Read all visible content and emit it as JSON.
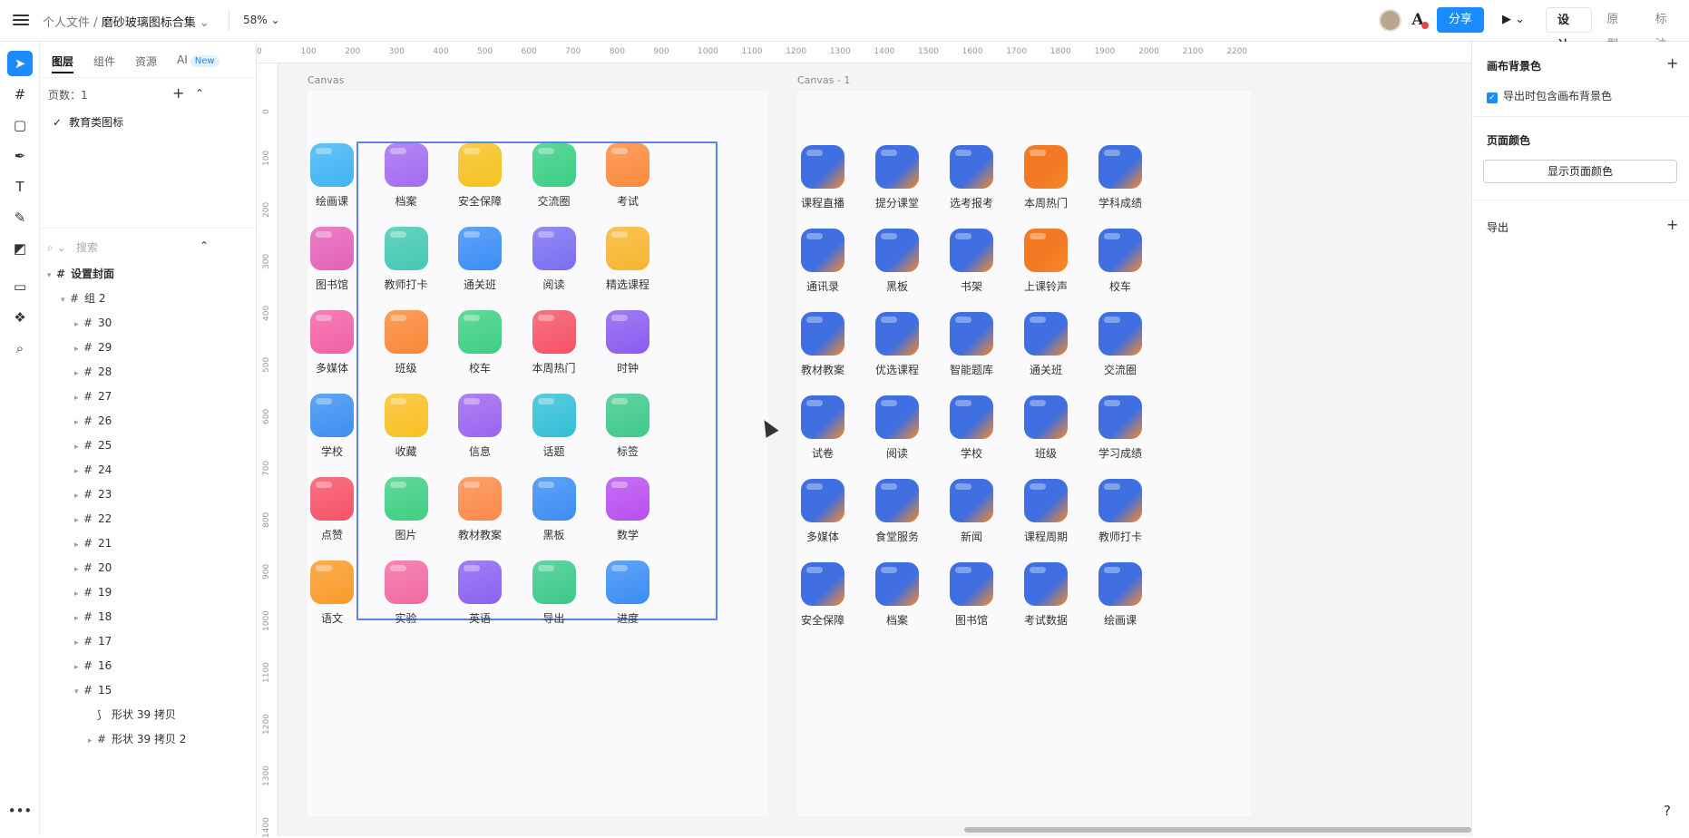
{
  "topbar": {
    "breadcrumb_root": "个人文件",
    "breadcrumb_sep": "/",
    "file_name": "磨砂玻璃图标合集",
    "zoom": "58%",
    "share_label": "分享",
    "modes": [
      "设计",
      "原型",
      "标注"
    ]
  },
  "left_panel": {
    "tabs": [
      "图层",
      "组件",
      "资源",
      "AI"
    ],
    "new_badge": "New",
    "page_count": "页数：1",
    "page_name": "教育类图标",
    "search_placeholder": "搜索",
    "layers": [
      {
        "label": "设置封面",
        "indent": 0,
        "arrow": "▾"
      },
      {
        "label": "组 2",
        "indent": 1,
        "arrow": "▾"
      },
      {
        "label": "30",
        "indent": 2,
        "arrow": "▸"
      },
      {
        "label": "29",
        "indent": 2,
        "arrow": "▸"
      },
      {
        "label": "28",
        "indent": 2,
        "arrow": "▸"
      },
      {
        "label": "27",
        "indent": 2,
        "arrow": "▸"
      },
      {
        "label": "26",
        "indent": 2,
        "arrow": "▸"
      },
      {
        "label": "25",
        "indent": 2,
        "arrow": "▸"
      },
      {
        "label": "24",
        "indent": 2,
        "arrow": "▸"
      },
      {
        "label": "23",
        "indent": 2,
        "arrow": "▸"
      },
      {
        "label": "22",
        "indent": 2,
        "arrow": "▸"
      },
      {
        "label": "21",
        "indent": 2,
        "arrow": "▸"
      },
      {
        "label": "20",
        "indent": 2,
        "arrow": "▸"
      },
      {
        "label": "19",
        "indent": 2,
        "arrow": "▸"
      },
      {
        "label": "18",
        "indent": 2,
        "arrow": "▸"
      },
      {
        "label": "17",
        "indent": 2,
        "arrow": "▸"
      },
      {
        "label": "16",
        "indent": 2,
        "arrow": "▸"
      },
      {
        "label": "15",
        "indent": 2,
        "arrow": "▾"
      },
      {
        "label": "形状 39 拷贝",
        "indent": 3,
        "arrow": ""
      },
      {
        "label": "形状 39 拷贝 2",
        "indent": 3,
        "arrow": "▸"
      }
    ]
  },
  "canvas": {
    "ruler_h": [
      "0",
      "100",
      "200",
      "300",
      "400",
      "500",
      "600",
      "700",
      "800",
      "900",
      "1000",
      "1100",
      "1200",
      "1300",
      "1400",
      "1500",
      "1600",
      "1700",
      "1800",
      "1900",
      "2000",
      "2100",
      "2200"
    ],
    "ruler_v": [
      "0",
      "100",
      "200",
      "300",
      "400",
      "500",
      "600",
      "700",
      "800",
      "900",
      "1000",
      "1100",
      "1200",
      "1300",
      "1400"
    ],
    "artboard1_label": "Canvas",
    "artboard2_label": "Canvas - 1",
    "artboard1_icons": [
      {
        "label": "绘画课",
        "color": "#3fb4f4"
      },
      {
        "label": "档案",
        "color": "#a36bf0"
      },
      {
        "label": "安全保障",
        "color": "#f6c21f"
      },
      {
        "label": "交流圈",
        "color": "#38cf84"
      },
      {
        "label": "考试",
        "color": "#fb8a3c"
      },
      {
        "label": "图书馆",
        "color": "#e561b8"
      },
      {
        "label": "教师打卡",
        "color": "#43c9b2"
      },
      {
        "label": "通关班",
        "color": "#3a8df5"
      },
      {
        "label": "阅读",
        "color": "#7a6ef2"
      },
      {
        "label": "精选课程",
        "color": "#f7b52e"
      },
      {
        "label": "多媒体",
        "color": "#f260a5"
      },
      {
        "label": "班级",
        "color": "#fb8736"
      },
      {
        "label": "校车",
        "color": "#3dcf82"
      },
      {
        "label": "本周热门",
        "color": "#f65266"
      },
      {
        "label": "时钟",
        "color": "#8a5cf0"
      },
      {
        "label": "学校",
        "color": "#3a90f2"
      },
      {
        "label": "收藏",
        "color": "#f8c022"
      },
      {
        "label": "信息",
        "color": "#9c64ef"
      },
      {
        "label": "话题",
        "color": "#32bfd6"
      },
      {
        "label": "标签",
        "color": "#3fc98a"
      },
      {
        "label": "点赞",
        "color": "#f55266"
      },
      {
        "label": "图片",
        "color": "#3dcf82"
      },
      {
        "label": "教材教案",
        "color": "#fb8a48"
      },
      {
        "label": "黑板",
        "color": "#3a8df5"
      },
      {
        "label": "数学",
        "color": "#b94ef0"
      },
      {
        "label": "语文",
        "color": "#fb9a28"
      },
      {
        "label": "实验",
        "color": "#f26aa0"
      },
      {
        "label": "英语",
        "color": "#8a62f1"
      },
      {
        "label": "导出",
        "color": "#3cc98a"
      },
      {
        "label": "进度",
        "color": "#3a8df5"
      }
    ],
    "artboard2_icons": [
      {
        "label": "课程直播",
        "color": "#3f6fe0"
      },
      {
        "label": "提分课堂",
        "color": "#3f6fe0"
      },
      {
        "label": "选考报考",
        "color": "#3f6fe0"
      },
      {
        "label": "本周热门",
        "color": "#f27a24"
      },
      {
        "label": "学科成绩",
        "color": "#3f6fe0"
      },
      {
        "label": "通讯录",
        "color": "#3f6fe0"
      },
      {
        "label": "黑板",
        "color": "#3f6fe0"
      },
      {
        "label": "书架",
        "color": "#3f6fe0"
      },
      {
        "label": "上课铃声",
        "color": "#f27a24"
      },
      {
        "label": "校车",
        "color": "#3f6fe0"
      },
      {
        "label": "教材教案",
        "color": "#3f6fe0"
      },
      {
        "label": "优选课程",
        "color": "#3f6fe0"
      },
      {
        "label": "智能题库",
        "color": "#3f6fe0"
      },
      {
        "label": "通关班",
        "color": "#3f6fe0"
      },
      {
        "label": "交流圈",
        "color": "#3f6fe0"
      },
      {
        "label": "试卷",
        "color": "#3f6fe0"
      },
      {
        "label": "阅读",
        "color": "#3f6fe0"
      },
      {
        "label": "学校",
        "color": "#3f6fe0"
      },
      {
        "label": "班级",
        "color": "#3f6fe0"
      },
      {
        "label": "学习成绩",
        "color": "#3f6fe0"
      },
      {
        "label": "多媒体",
        "color": "#3f6fe0"
      },
      {
        "label": "食堂服务",
        "color": "#3f6fe0"
      },
      {
        "label": "新闻",
        "color": "#3f6fe0"
      },
      {
        "label": "课程周期",
        "color": "#3f6fe0"
      },
      {
        "label": "教师打卡",
        "color": "#3f6fe0"
      },
      {
        "label": "安全保障",
        "color": "#3f6fe0"
      },
      {
        "label": "档案",
        "color": "#3f6fe0"
      },
      {
        "label": "图书馆",
        "color": "#3f6fe0"
      },
      {
        "label": "考试数据",
        "color": "#3f6fe0"
      },
      {
        "label": "绘画课",
        "color": "#3f6fe0"
      }
    ]
  },
  "right_panel": {
    "bg_title": "画布背景色",
    "export_bg_label": "导出时包含画布背景色",
    "page_color_title": "页面颜色",
    "show_page_color": "显示页面颜色",
    "export_title": "导出"
  },
  "icons": [
    "menu-icon",
    "chevron-down-icon",
    "play-icon",
    "pointer-icon",
    "frame-icon",
    "rect-icon",
    "pen-icon",
    "text-icon",
    "pencil-icon",
    "comment-icon",
    "plugin-icon",
    "search-icon",
    "help-icon",
    "plus-icon",
    "check-icon"
  ]
}
